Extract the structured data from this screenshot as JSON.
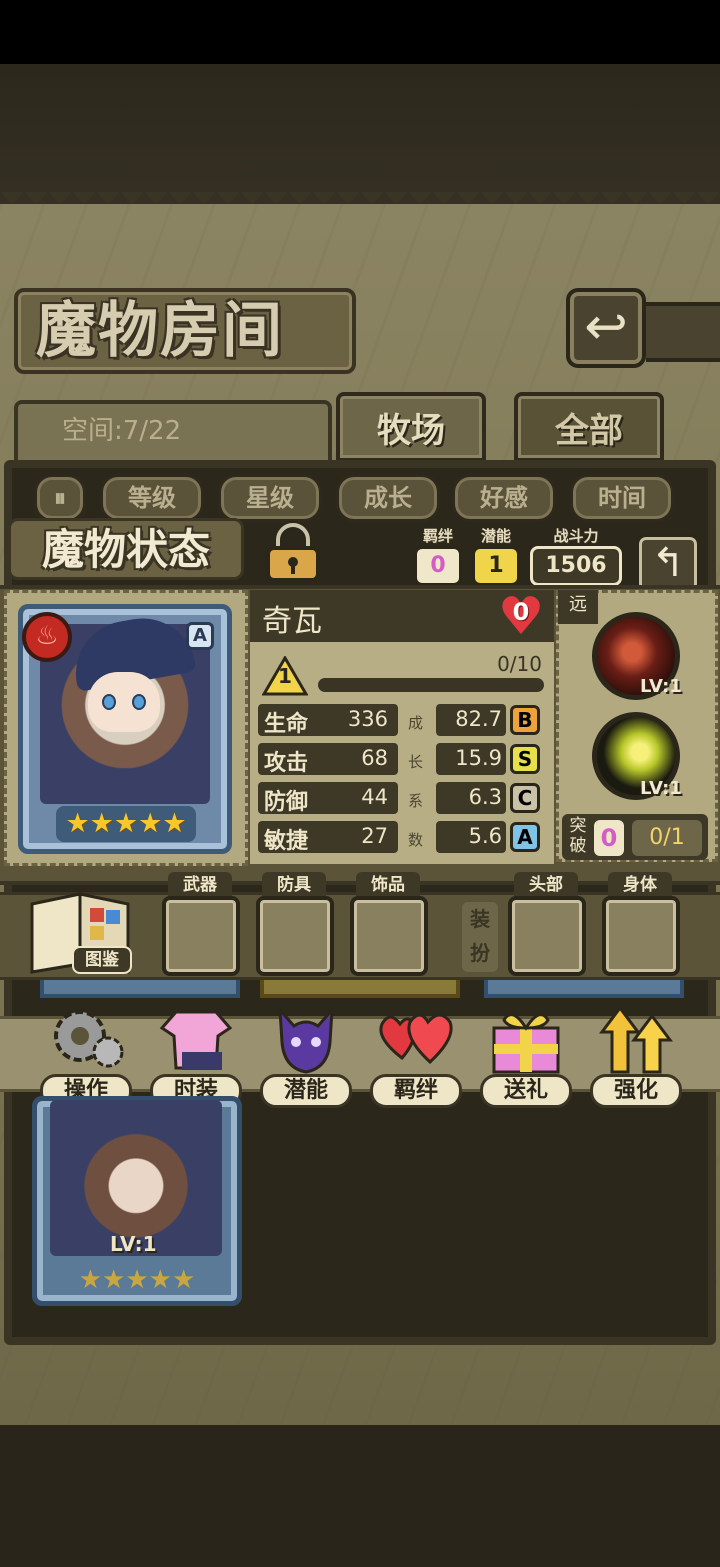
{
  "room": {
    "title": "魔物房间",
    "back_icon": "return-arrow-icon",
    "space_label": "空间:7/22",
    "tabs": [
      {
        "label": "牧场",
        "active": true
      },
      {
        "label": "全部",
        "active": false
      }
    ]
  },
  "sort": {
    "toggle_icon": "sort-toggle-icon",
    "buttons": [
      "等级",
      "星级",
      "成长",
      "好感",
      "时间"
    ]
  },
  "status": {
    "title": "魔物状态",
    "lock_icon": "padlock-icon",
    "bond": {
      "label": "羁绊",
      "value": "0"
    },
    "potential": {
      "label": "潜能",
      "value": "1"
    },
    "power": {
      "label": "战斗力",
      "value": "1506"
    },
    "back_icon": "return-arrow-icon"
  },
  "monster": {
    "name": "奇瓦",
    "element_icon": "fire-element-icon",
    "rank": "A",
    "stars": 5,
    "affection": "0",
    "level": "1",
    "exp": "0/10",
    "exp_fraction": 0,
    "stats": [
      {
        "name": "生命",
        "value": "336",
        "growth": "82.7",
        "grade": "B",
        "grade_color": "#f0a23a"
      },
      {
        "name": "攻击",
        "value": "68",
        "growth": "15.9",
        "grade": "S",
        "grade_color": "#e8e04a"
      },
      {
        "name": "防御",
        "value": "44",
        "growth": "6.3",
        "grade": "C",
        "grade_color": "#c9c2a8"
      },
      {
        "name": "敏捷",
        "value": "27",
        "growth": "5.6",
        "grade": "A",
        "grade_color": "#7fc3e6"
      }
    ],
    "growth_chars": [
      "成",
      "长",
      "系",
      "数"
    ],
    "range": "远",
    "skills": [
      {
        "icon": "dark-flame-skill-icon",
        "level": "LV:1"
      },
      {
        "icon": "yellow-orb-burst-skill-icon",
        "level": "LV:1"
      }
    ],
    "breakthrough": {
      "label": "突破",
      "value": "0",
      "progress": "0/1"
    }
  },
  "equipment": {
    "book_label": "图鉴",
    "slots": [
      "武器",
      "防具",
      "饰品"
    ],
    "dress_label": "装扮",
    "dress_slots": [
      "头部",
      "身体"
    ]
  },
  "actions": [
    {
      "label": "操作",
      "icon": "gear-icon"
    },
    {
      "label": "时装",
      "icon": "outfit-icon"
    },
    {
      "label": "潜能",
      "icon": "shadow-spirit-icon"
    },
    {
      "label": "羁绊",
      "icon": "hearts-icon"
    },
    {
      "label": "送礼",
      "icon": "gift-icon"
    },
    {
      "label": "强化",
      "icon": "upgrade-arrows-icon"
    }
  ],
  "list_card": {
    "level": "LV:1",
    "stars": 5
  }
}
